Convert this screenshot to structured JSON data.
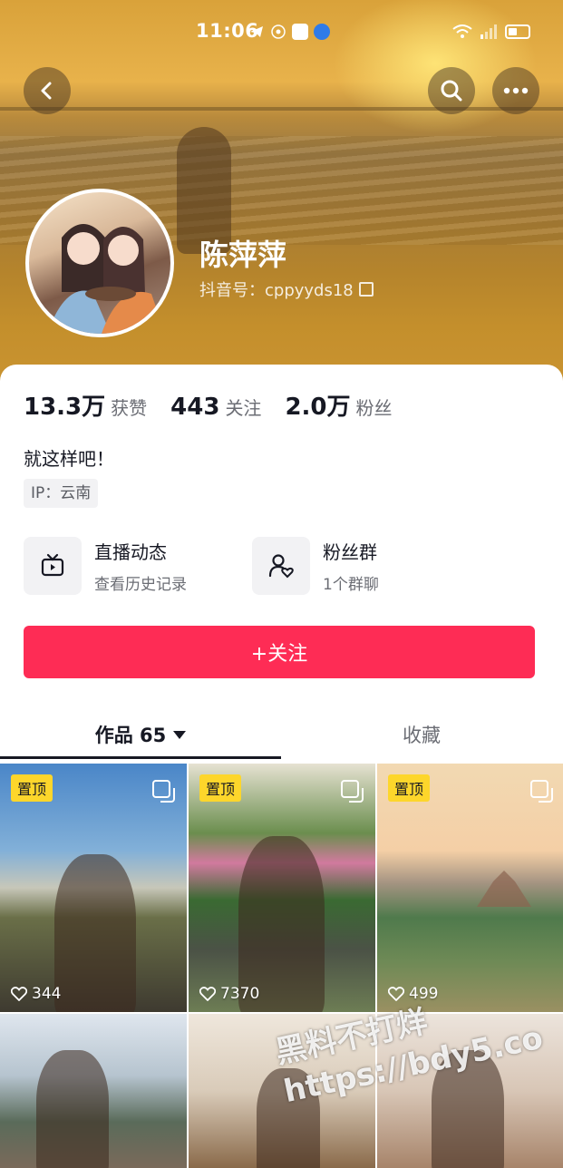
{
  "status_bar": {
    "time": "11:06"
  },
  "profile": {
    "nickname": "陈萍萍",
    "douyin_id_label": "抖音号：cppyyds18",
    "stats": [
      {
        "value": "13.3万",
        "label": "获赞"
      },
      {
        "value": "443",
        "label": "关注"
      },
      {
        "value": "2.0万",
        "label": "粉丝"
      }
    ],
    "bio": "就这样吧！",
    "ip": "IP：云南"
  },
  "features": [
    {
      "title": "直播动态",
      "subtitle": "查看历史记录",
      "icon": "tv-icon"
    },
    {
      "title": "粉丝群",
      "subtitle": "1个群聊",
      "icon": "fan-group-icon"
    }
  ],
  "follow_button": "+关注",
  "tabs": [
    {
      "label": "作品 65",
      "active": true
    },
    {
      "label": "收藏",
      "active": false
    }
  ],
  "videos": [
    {
      "pinned": "置顶",
      "likes": "344"
    },
    {
      "pinned": "置顶",
      "likes": "7370"
    },
    {
      "pinned": "置顶",
      "likes": "499"
    }
  ],
  "watermark": {
    "line1": "黑料不打烊",
    "line2": "https://bdy5.co"
  },
  "colors": {
    "accent": "#fe2c55",
    "pin": "#fdd62b"
  }
}
